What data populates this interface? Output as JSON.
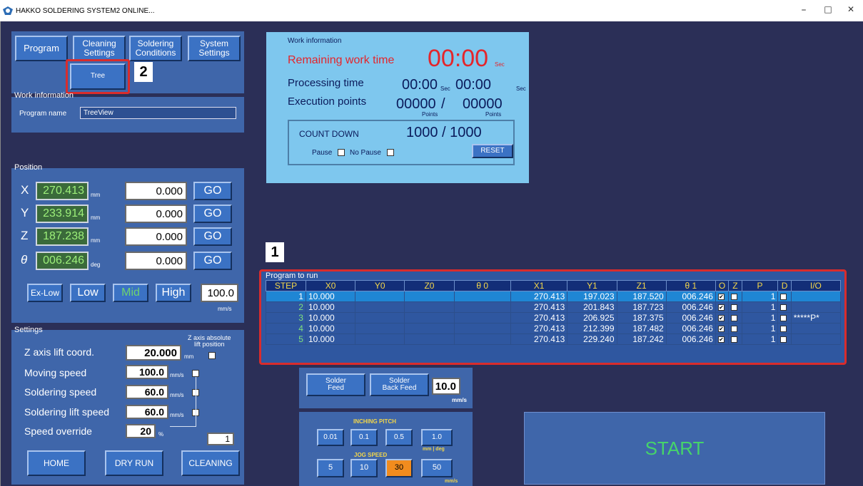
{
  "titlebar": {
    "title": "HAKKO SOLDERING SYSTEM2 ONLINE...",
    "minimize": "–",
    "maximize": "□",
    "close": "✕"
  },
  "nav": {
    "program": "Program",
    "cleaning": "Cleaning\nSettings",
    "soldering": "Soldering\nConditions",
    "system": "System\nSettings",
    "tree": "Tree"
  },
  "callouts": {
    "one": "1",
    "two": "2"
  },
  "work_info_left": {
    "label": "Work information",
    "program_name_label": "Program name",
    "program_name_value": "TreeView"
  },
  "position": {
    "label": "Position",
    "rows": [
      {
        "axis": "X",
        "current": "270.413",
        "unit": "mm",
        "target": "0.000",
        "go": "GO"
      },
      {
        "axis": "Y",
        "current": "233.914",
        "unit": "mm",
        "target": "0.000",
        "go": "GO"
      },
      {
        "axis": "Z",
        "current": "187.238",
        "unit": "mm",
        "target": "0.000",
        "go": "GO"
      },
      {
        "axis": "θ",
        "current": "006.246",
        "unit": "deg",
        "target": "0.000",
        "go": "GO"
      }
    ],
    "speeds": {
      "exlow": "Ex-Low",
      "low": "Low",
      "mid": "Mid",
      "high": "High"
    },
    "speed_value": "100.0",
    "speed_unit": "mm/s"
  },
  "settings": {
    "label": "Settings",
    "z_abs_label": "Z axis absolute\nlift position",
    "z_lift_label": "Z axis lift coord.",
    "z_lift_value": "20.000",
    "z_lift_unit": "mm",
    "moving_label": "Moving speed",
    "moving_value": "100.0",
    "soldering_label": "Soldering speed",
    "soldering_value": "60.0",
    "lift_label": "Soldering lift speed",
    "lift_value": "60.0",
    "speed_unit": "mm/s",
    "override_label": "Speed override",
    "override_value": "20",
    "override_unit": "%",
    "counter_value": "1",
    "home": "HOME",
    "dry_run": "DRY RUN",
    "cleaning": "CLEANING"
  },
  "work_info": {
    "label": "Work information",
    "remaining_label": "Remaining work time",
    "remaining_value": "00:00",
    "sec": "Sec",
    "processing_label": "Processing time",
    "processing_value1": "00:00",
    "processing_value2": "00:00",
    "exec_label": "Execution points",
    "exec_value1": "00000",
    "exec_sep": "/",
    "exec_value2": "00000",
    "points": "Points",
    "countdown_label": "COUNT DOWN",
    "countdown_value": "1000 / 1000",
    "pause": "Pause",
    "no_pause": "No Pause",
    "reset": "RESET"
  },
  "program_table": {
    "label": "Program to run",
    "headers": [
      "STEP",
      "X0",
      "Y0",
      "Z0",
      "θ 0",
      "X1",
      "Y1",
      "Z1",
      "θ 1",
      "O",
      "Z",
      "P",
      "D",
      "I/O"
    ],
    "rows": [
      {
        "step": "1",
        "x0": "10.000",
        "y0": "",
        "z0": "",
        "t0": "",
        "x1": "270.413",
        "y1": "197.023",
        "z1": "187.520",
        "t1": "006.246",
        "o": true,
        "z": false,
        "p": "1",
        "d": false,
        "io": ""
      },
      {
        "step": "2",
        "x0": "10.000",
        "y0": "",
        "z0": "",
        "t0": "",
        "x1": "270.413",
        "y1": "201.843",
        "z1": "187.723",
        "t1": "006.246",
        "o": true,
        "z": false,
        "p": "1",
        "d": false,
        "io": ""
      },
      {
        "step": "3",
        "x0": "10.000",
        "y0": "",
        "z0": "",
        "t0": "",
        "x1": "270.413",
        "y1": "206.925",
        "z1": "187.375",
        "t1": "006.246",
        "o": true,
        "z": false,
        "p": "1",
        "d": false,
        "io": "*****P*"
      },
      {
        "step": "4",
        "x0": "10.000",
        "y0": "",
        "z0": "",
        "t0": "",
        "x1": "270.413",
        "y1": "212.399",
        "z1": "187.482",
        "t1": "006.246",
        "o": true,
        "z": false,
        "p": "1",
        "d": false,
        "io": ""
      },
      {
        "step": "5",
        "x0": "10.000",
        "y0": "",
        "z0": "",
        "t0": "",
        "x1": "270.413",
        "y1": "229.240",
        "z1": "187.242",
        "t1": "006.246",
        "o": true,
        "z": false,
        "p": "1",
        "d": false,
        "io": ""
      }
    ]
  },
  "solder": {
    "feed": "Solder\nFeed",
    "back_feed": "Solder\nBack Feed",
    "value": "10.0",
    "unit": "mm/s"
  },
  "jog": {
    "inching_label": "INCHING PITCH",
    "pitches": [
      "0.01",
      "0.1",
      "0.5",
      "1.0"
    ],
    "pitch_unit": "mm | deg",
    "speed_label": "JOG SPEED",
    "speeds": [
      "5",
      "10",
      "30",
      "50"
    ],
    "speed_unit": "mm/s",
    "active_speed_color": "#f28c1e"
  },
  "start": "START",
  "colors": {
    "background": "#2b2f57",
    "panel": "#3f66aa",
    "button": "#3b72c4",
    "work_info_bg": "#7ec7ee",
    "highlight_red": "#d92c2c",
    "start_text": "#46d46a"
  }
}
